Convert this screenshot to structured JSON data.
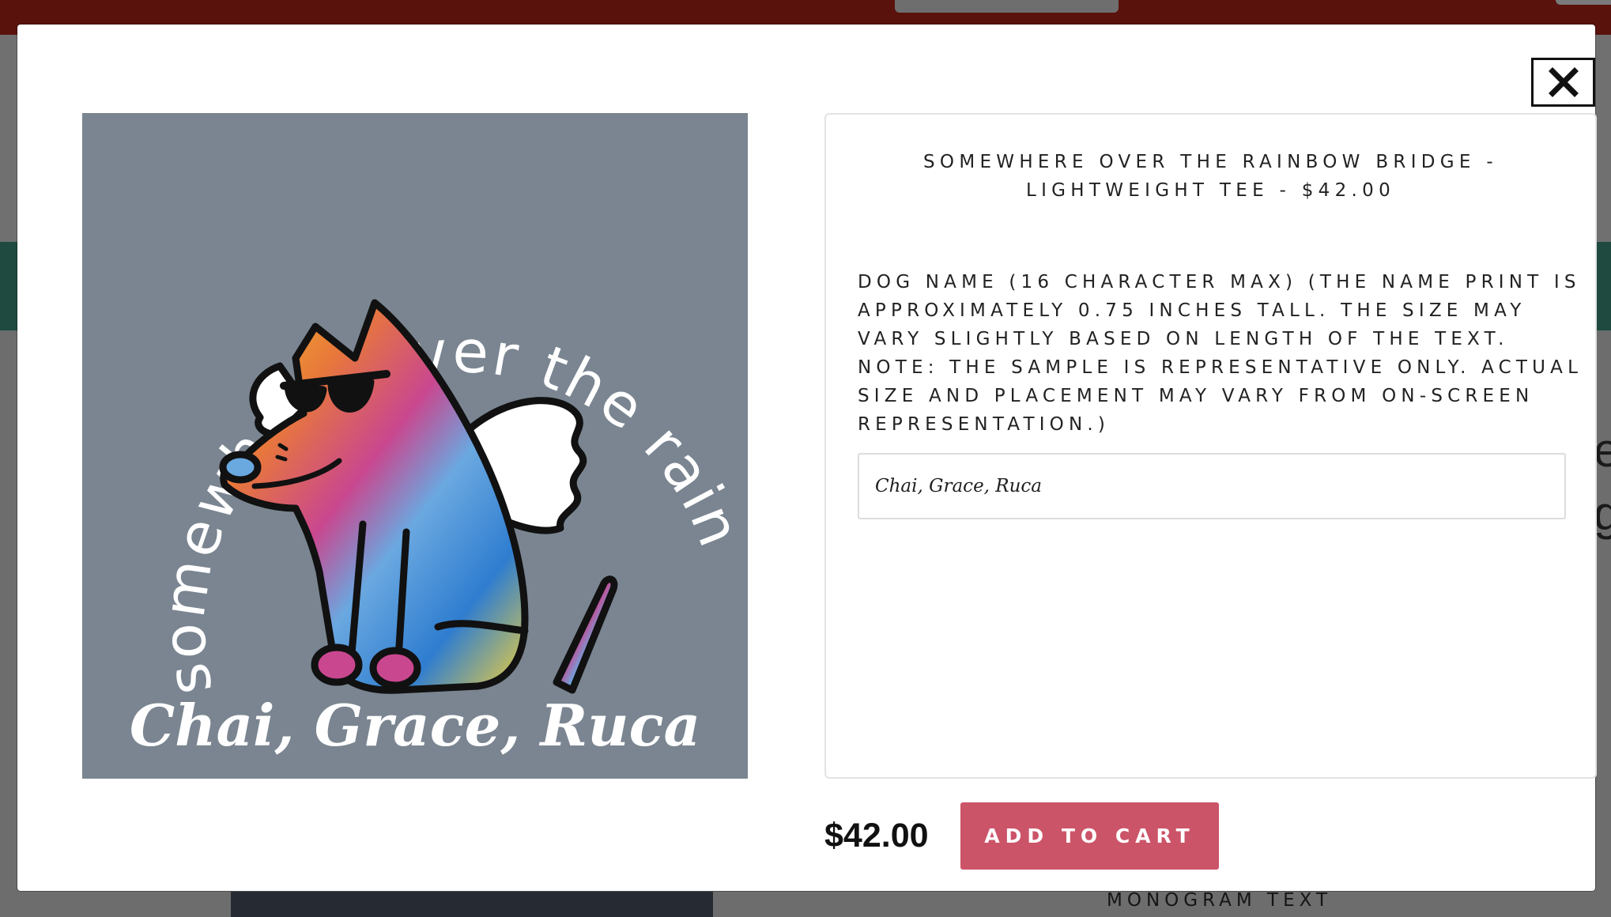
{
  "background_page": {
    "monogram_label": "MONOGRAM TEXT",
    "right_edge_text": "e\ng"
  },
  "modal": {
    "close_icon": "close-x-icon",
    "artwork": {
      "arc_text": "somewhere over the rainbow bridge",
      "name_text": "Chai, Grace, Ruca",
      "icon": "rainbow-angel-dog-illustration"
    },
    "product": {
      "title_line1": "SOMEWHERE OVER THE RAINBOW BRIDGE -",
      "title_line2": "LIGHTWEIGHT TEE - $42.00"
    },
    "option": {
      "label_lines": [
        "DOG NAME (16 CHARACTER MAX) (THE NAME PRINT IS",
        "APPROXIMATELY 0.75 INCHES TALL. THE SIZE MAY",
        "VARY SLIGHTLY BASED ON LENGTH OF THE TEXT.",
        "NOTE: THE SAMPLE IS REPRESENTATIVE ONLY. ACTUAL",
        "SIZE AND PLACEMENT MAY VARY FROM ON-SCREEN",
        "REPRESENTATION.)"
      ],
      "input_value": "Chai, Grace, Ruca"
    },
    "price": "$42.00",
    "add_to_cart_label": "ADD TO CART"
  },
  "colors": {
    "top_bar": "#5a120c",
    "nav_bar": "#1e4a3f",
    "shirt_heather": "#7a8591",
    "cart_button": "#cc5468"
  }
}
